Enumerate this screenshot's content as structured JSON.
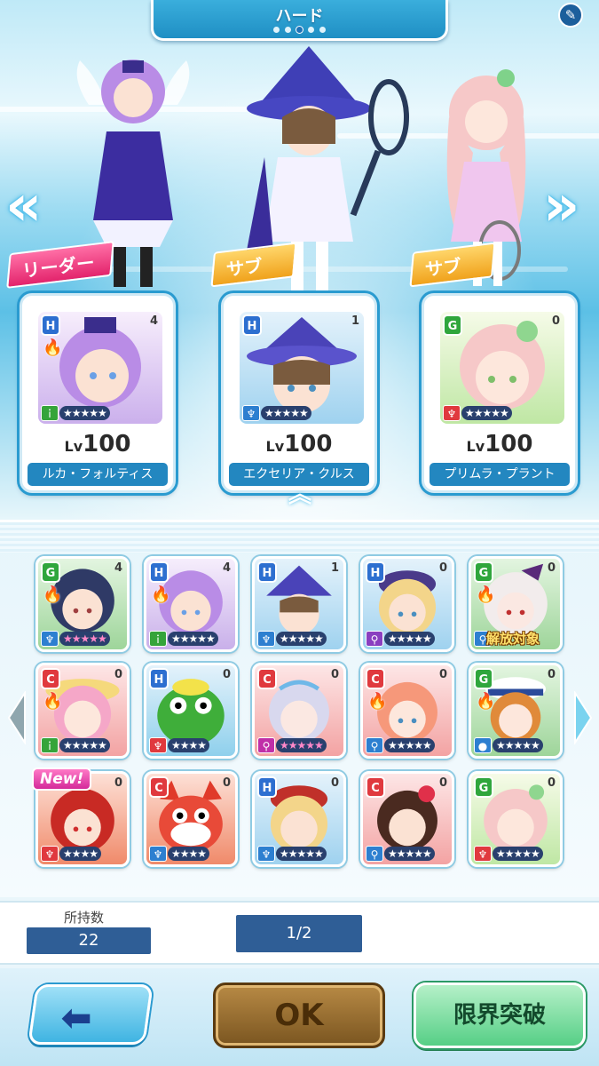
{
  "header": {
    "mode_title": "ハード",
    "page_dots": 5,
    "active_dot": 3
  },
  "team": {
    "leader_tag": "リーダー",
    "sub_tag": "サブ",
    "members": [
      {
        "name": "ルカ・フォルティス",
        "level_prefix": "Lv",
        "level": "100",
        "rank": "H",
        "count": "4",
        "skill": "bat",
        "element": "fire"
      },
      {
        "name": "エクセリア・クルス",
        "level_prefix": "Lv",
        "level": "100",
        "rank": "H",
        "count": "1",
        "skill": "racket",
        "element": "none"
      },
      {
        "name": "プリムラ・プラント",
        "level_prefix": "Lv",
        "level": "100",
        "rank": "G",
        "count": "0",
        "skill": "racket",
        "element": "none"
      }
    ]
  },
  "grid": {
    "release_label": "解放対象",
    "new_label": "New!",
    "items": [
      {
        "rank": "G",
        "count": "4",
        "stars": "★★★★★",
        "element": "fire"
      },
      {
        "rank": "H",
        "count": "4",
        "stars": "★★★★★",
        "element": "fire"
      },
      {
        "rank": "H",
        "count": "1",
        "stars": "★★★★★",
        "element": "none"
      },
      {
        "rank": "H",
        "count": "0",
        "stars": "★★★★★",
        "element": "none"
      },
      {
        "rank": "G",
        "count": "0",
        "stars": "",
        "element": "fire"
      },
      {
        "rank": "C",
        "count": "0",
        "stars": "★★★★★",
        "element": "fire"
      },
      {
        "rank": "H",
        "count": "0",
        "stars": "★★★★",
        "element": "none"
      },
      {
        "rank": "C",
        "count": "0",
        "stars": "★★★★★",
        "element": "none"
      },
      {
        "rank": "C",
        "count": "0",
        "stars": "★★★★★",
        "element": "fire"
      },
      {
        "rank": "G",
        "count": "0",
        "stars": "★★★★★",
        "element": "fire"
      },
      {
        "rank": "",
        "count": "0",
        "stars": "★★★★",
        "element": "none"
      },
      {
        "rank": "C",
        "count": "0",
        "stars": "★★★★",
        "element": "none"
      },
      {
        "rank": "H",
        "count": "0",
        "stars": "★★★★★",
        "element": "none"
      },
      {
        "rank": "C",
        "count": "0",
        "stars": "★★★★★",
        "element": "none"
      },
      {
        "rank": "G",
        "count": "0",
        "stars": "★★★★★",
        "element": "none"
      }
    ]
  },
  "footer": {
    "owned_label": "所持数",
    "owned_value": "22",
    "page_value": "1/2"
  },
  "buttons": {
    "ok": "OK",
    "limit_break": "限界突破"
  },
  "colors": {
    "rank_H": "#2d6fd0",
    "rank_G": "#2fa63c",
    "rank_C": "#e0393e",
    "panel_blue": "#2f5e96"
  }
}
